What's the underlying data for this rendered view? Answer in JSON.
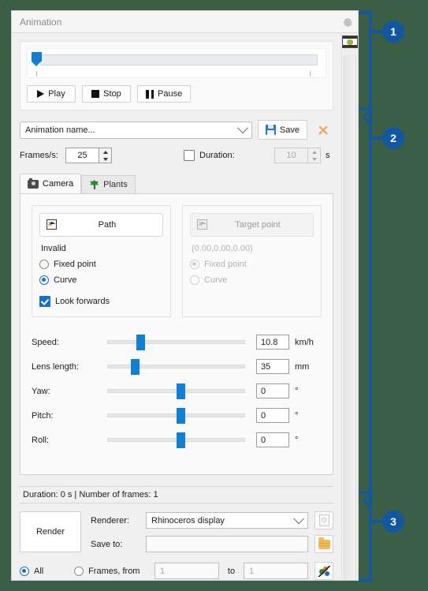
{
  "window": {
    "title": "Animation",
    "settings_icon": "gear-icon",
    "dock_icon": "render-panel-icon"
  },
  "playback": {
    "timeline_position_pct": 3,
    "buttons": [
      {
        "label": "Play",
        "icon": "play-icon"
      },
      {
        "label": "Stop",
        "icon": "stop-icon"
      },
      {
        "label": "Pause",
        "icon": "pause-icon"
      }
    ]
  },
  "name_row": {
    "combo_value": "Animation name...",
    "combo_icon": "chevron-down-icon",
    "save_label": "Save",
    "save_icon": "floppy-disk-icon",
    "delete_icon": "close-x-icon"
  },
  "settings_row": {
    "frames_label": "Frames/s:",
    "frames_value": "25",
    "duration_label": "Duration:",
    "duration_checked": false,
    "duration_value": "10",
    "duration_unit": "s"
  },
  "tabs": [
    {
      "label": "Camera",
      "icon": "camera-icon",
      "active": true
    },
    {
      "label": "Plants",
      "icon": "leaf-icon",
      "active": false
    }
  ],
  "path_group": {
    "button_label": "Path",
    "button_icon": "pick-object-icon",
    "status": "Invalid",
    "options": [
      {
        "label": "Fixed point",
        "selected": false
      },
      {
        "label": "Curve",
        "selected": true
      }
    ],
    "checkbox": {
      "label": "Look forwards",
      "checked": true
    }
  },
  "target_group": {
    "button_label": "Target point",
    "button_icon": "pick-point-icon",
    "disabled": true,
    "coordinates": "(0.00,0.00,0.00)",
    "options": [
      {
        "label": "Fixed point",
        "selected": true
      },
      {
        "label": "Curve",
        "selected": false
      }
    ]
  },
  "sliders": [
    {
      "label": "Speed:",
      "value": "10.8",
      "unit": "km/h",
      "pct": 21
    },
    {
      "label": "Lens length:",
      "value": "35",
      "unit": "mm",
      "pct": 17
    },
    {
      "label": "Yaw:",
      "value": "0",
      "unit": "°",
      "pct": 50
    },
    {
      "label": "Pitch:",
      "value": "0",
      "unit": "°",
      "pct": 50
    },
    {
      "label": "Roll:",
      "value": "0",
      "unit": "°",
      "pct": 50
    }
  ],
  "status_bar": {
    "text": "Duration: 0 s  |  Number of frames: 1"
  },
  "render": {
    "render_label": "Render",
    "renderer_label": "Renderer:",
    "renderer_value": "Rhinoceros display",
    "renderer_chevron": "chevron-down-icon",
    "renderer_settings_icon": "document-settings-icon",
    "saveto_label": "Save to:",
    "saveto_value": "",
    "browse_icon": "folder-icon",
    "range": {
      "all_label": "All",
      "all_selected": true,
      "frames_label": "Frames, from",
      "frames_selected": false,
      "from_value": "1",
      "to_label": "to",
      "to_value": "1",
      "preview_icon": "render-preview-icon"
    }
  },
  "callouts": [
    {
      "number": "1"
    },
    {
      "number": "2"
    },
    {
      "number": "3"
    }
  ],
  "colors": {
    "accent_blue": "#0f80d6",
    "callout_blue": "#12579f",
    "background_green": "#3b5e46",
    "delete_orange": "#f0a14a"
  }
}
